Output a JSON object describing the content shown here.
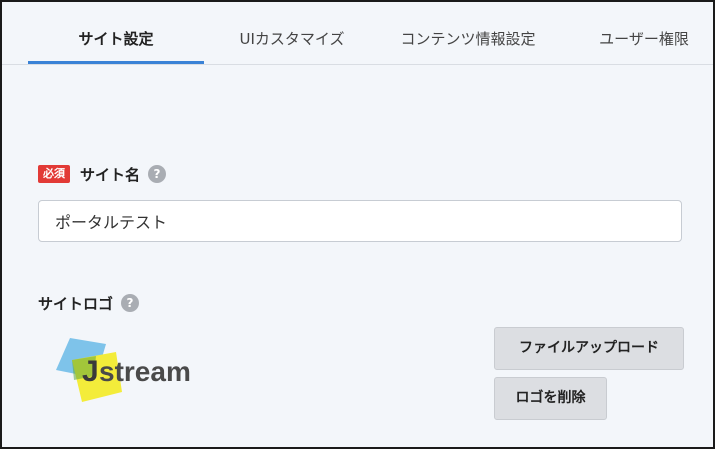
{
  "tabs": [
    {
      "label": "サイト設定",
      "active": true
    },
    {
      "label": "UIカスタマイズ",
      "active": false
    },
    {
      "label": "コンテンツ情報設定",
      "active": false
    },
    {
      "label": "ユーザー権限",
      "active": false
    }
  ],
  "site_name": {
    "required_badge": "必須",
    "label": "サイト名",
    "help": "?",
    "value": "ポータルテスト"
  },
  "site_logo": {
    "label": "サイトロゴ",
    "help": "?",
    "logo_text_j": "J",
    "logo_text_rest": "stream",
    "upload_label": "ファイルアップロード",
    "delete_label": "ロゴを削除"
  },
  "colors": {
    "accent": "#3a82d6",
    "required": "#e23a36",
    "logo_blue": "#7ec3ea",
    "logo_yellow": "#f3ec3a",
    "logo_green": "#5fa83a",
    "logo_text": "#4a4a4a"
  }
}
